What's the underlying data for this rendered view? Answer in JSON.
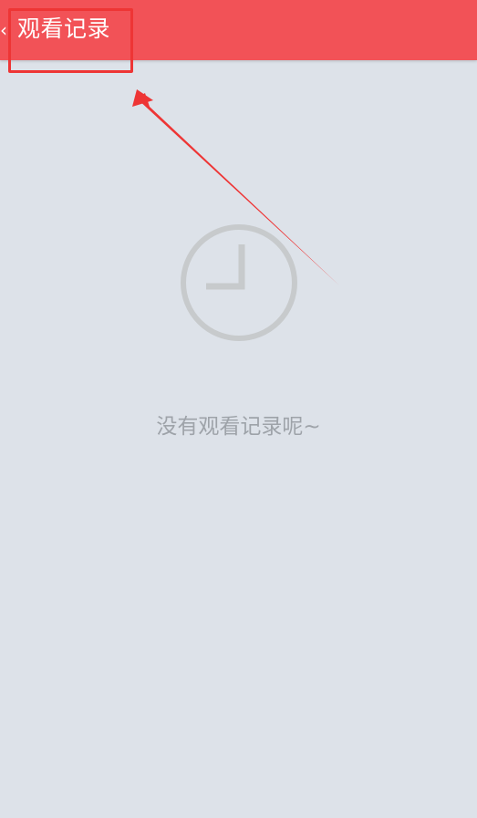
{
  "header": {
    "back_glyph": "‹",
    "title": "观看记录",
    "background": "#f25257"
  },
  "empty_state": {
    "icon": "clock-icon",
    "message": "没有观看记录呢~"
  },
  "annotation": {
    "color": "#ee3535"
  }
}
